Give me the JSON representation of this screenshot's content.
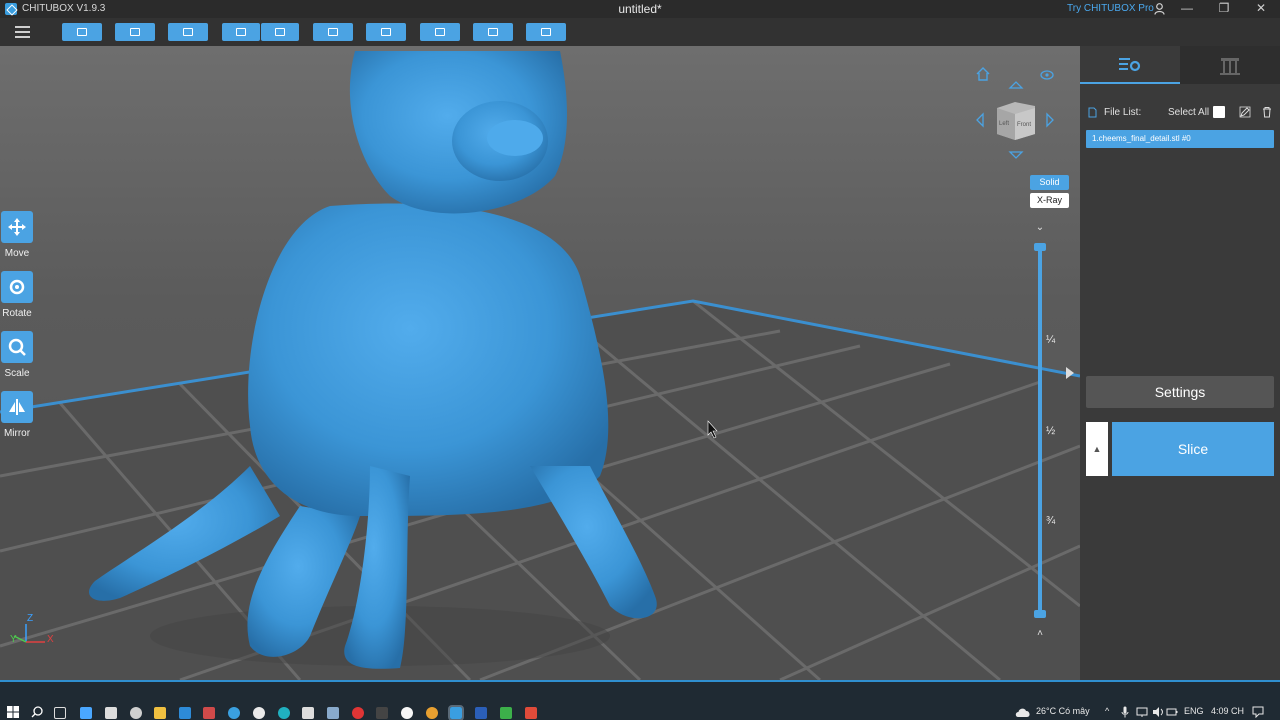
{
  "titlebar": {
    "app_name": "CHITUBOX V1.9.3",
    "document_title": "untitled*",
    "pro_link": "Try CHITUBOX Pro",
    "minimize": "—",
    "restore": "❐",
    "close": "✕"
  },
  "toolbar": {
    "buttons": [
      "open-file",
      "save",
      "import",
      "export-left",
      "export-right",
      "duplicate",
      "support",
      "hollow",
      "dig-hole",
      "arrange"
    ]
  },
  "tools": {
    "move": "Move",
    "rotate": "Rotate",
    "scale": "Scale",
    "mirror": "Mirror"
  },
  "nav_cube": {
    "left": "Left",
    "front": "Front"
  },
  "view_modes": {
    "solid": "Solid",
    "xray": "X-Ray"
  },
  "layer_slider": {
    "quarter": "¼",
    "half": "½",
    "three_quarter": "¾"
  },
  "axes": {
    "x": "X",
    "y": "Y",
    "z": "Z"
  },
  "right_panel": {
    "file_list_label": "File List:",
    "select_all_label": "Select All",
    "file_entry": "1.cheems_final_detail.stl #0",
    "settings_button": "Settings",
    "slice_button": "Slice",
    "slice_side": "▲"
  },
  "taskbar": {
    "weather": "26°C  Có mây",
    "language": "ENG",
    "time": "4:09 CH"
  },
  "colors": {
    "accent": "#4ba3e3",
    "model": "#3b95d6",
    "platform_edge": "#3b8fcf"
  }
}
